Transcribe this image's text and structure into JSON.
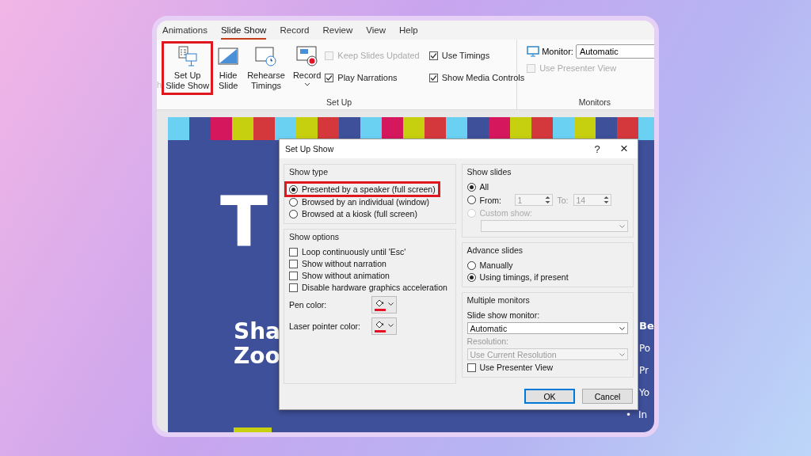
{
  "ribbon": {
    "tabs": [
      {
        "label": "Animations",
        "selected": false
      },
      {
        "label": "Slide Show",
        "selected": true
      },
      {
        "label": "Record",
        "selected": false
      },
      {
        "label": "Review",
        "selected": false
      },
      {
        "label": "View",
        "selected": false
      },
      {
        "label": "Help",
        "selected": false
      }
    ],
    "cut_label": "h",
    "buttons": [
      {
        "kind": "setup",
        "lines": [
          "Set Up",
          "Slide Show"
        ],
        "highlighted": true
      },
      {
        "kind": "hide",
        "lines": [
          "Hide",
          "Slide"
        ],
        "highlighted": false
      },
      {
        "kind": "rehearse",
        "lines": [
          "Rehearse",
          "Timings"
        ],
        "highlighted": false
      },
      {
        "kind": "record",
        "lines": [
          "Record"
        ],
        "highlighted": false,
        "dropdown": true
      }
    ],
    "checks": [
      {
        "label": "Keep Slides Updated",
        "checked": false,
        "disabled": true
      },
      {
        "label": "Play Narrations",
        "checked": true,
        "disabled": false
      },
      {
        "label": "Use Timings",
        "checked": true,
        "disabled": false
      },
      {
        "label": "Show Media Controls",
        "checked": true,
        "disabled": false
      }
    ],
    "group_label": "Set Up",
    "monitors": {
      "label": "Monitor:",
      "value": "Automatic",
      "presenter": {
        "label": "Use Presenter View",
        "checked": false,
        "disabled": true
      },
      "group_label": "Monitors"
    }
  },
  "slide": {
    "title": "T",
    "subtitle_lines": [
      "Sha",
      "Zoo"
    ],
    "right_heading": "Be",
    "right_items": [
      {
        "text": "Po"
      },
      {
        "text": "Pr"
      },
      {
        "text": "Yo"
      },
      {
        "text": "In",
        "bullet": "•"
      }
    ]
  },
  "dialog": {
    "title": "Set Up Show",
    "help": "?",
    "close": "×",
    "show_type": {
      "legend": "Show type",
      "options": [
        {
          "label": "Presented by a speaker (full screen)",
          "selected": true,
          "highlighted": true
        },
        {
          "label": "Browsed by an individual (window)",
          "selected": false,
          "highlighted": false
        },
        {
          "label": "Browsed at a kiosk (full screen)",
          "selected": false,
          "highlighted": false
        }
      ]
    },
    "show_options": {
      "legend": "Show options",
      "checks": [
        {
          "label": "Loop continuously until 'Esc'",
          "checked": false
        },
        {
          "label": "Show without narration",
          "checked": false
        },
        {
          "label": "Show without animation",
          "checked": false
        },
        {
          "label": "Disable hardware graphics acceleration",
          "checked": false
        }
      ],
      "colors": [
        {
          "label": "Pen color:",
          "color": "#e81123"
        },
        {
          "label": "Laser pointer color:",
          "color": "#e81123"
        }
      ]
    },
    "show_slides": {
      "legend": "Show slides",
      "options": [
        {
          "kind": "all",
          "label": "All",
          "selected": true,
          "disabled": false
        },
        {
          "kind": "range",
          "label": "From:",
          "selected": false,
          "disabled": false,
          "from": "1",
          "to_label": "To:",
          "to": "14"
        },
        {
          "kind": "custom",
          "label": "Custom show:",
          "selected": false,
          "disabled": true
        }
      ]
    },
    "advance": {
      "legend": "Advance slides",
      "options": [
        {
          "label": "Manually",
          "selected": false
        },
        {
          "label": "Using timings, if present",
          "selected": true
        }
      ]
    },
    "monitors": {
      "legend": "Multiple monitors",
      "monitor_label": "Slide show monitor:",
      "monitor_value": "Automatic",
      "resolution_label": "Resolution:",
      "resolution_value": "Use Current Resolution",
      "resolution_disabled": true,
      "presenter": {
        "label": "Use Presenter View",
        "checked": false
      }
    },
    "buttons": [
      {
        "label": "OK",
        "default": true
      },
      {
        "label": "Cancel",
        "default": false
      }
    ]
  }
}
